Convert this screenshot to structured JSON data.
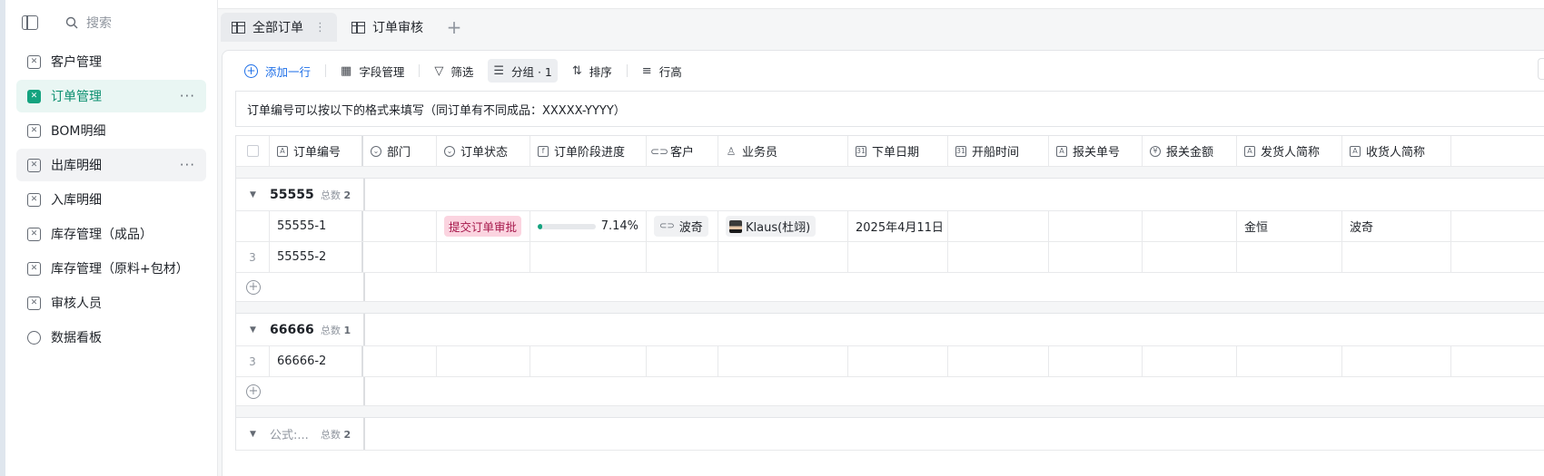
{
  "sidebar": {
    "search_placeholder": "搜索",
    "items": [
      {
        "label": "客户管理"
      },
      {
        "label": "订单管理"
      },
      {
        "label": "BOM明细"
      },
      {
        "label": "出库明细"
      },
      {
        "label": "入库明细"
      },
      {
        "label": "库存管理（成品）"
      },
      {
        "label": "库存管理（原料+包材）"
      },
      {
        "label": "审核人员"
      },
      {
        "label": "数据看板"
      }
    ],
    "more": "···"
  },
  "tabs": [
    {
      "label": "全部订单"
    },
    {
      "label": "订单审核"
    }
  ],
  "toolbar": {
    "add_row": "添加一行",
    "fields": "字段管理",
    "filter": "筛选",
    "group": "分组 · 1",
    "sort": "排序",
    "row_height": "行高"
  },
  "notice": "订单编号可以按以下的格式来填写（同订单有不同成品：XXXXX-YYYY）",
  "columns": [
    {
      "label": "订单编号",
      "icon": "text-icon"
    },
    {
      "label": "部门",
      "icon": "single-select-icon"
    },
    {
      "label": "订单状态",
      "icon": "single-select-icon"
    },
    {
      "label": "订单阶段进度",
      "icon": "formula-icon"
    },
    {
      "label": "客户",
      "icon": "link-icon"
    },
    {
      "label": "业务员",
      "icon": "person-icon"
    },
    {
      "label": "下单日期",
      "icon": "date-icon"
    },
    {
      "label": "开船时间",
      "icon": "date-icon"
    },
    {
      "label": "报关单号",
      "icon": "text-icon"
    },
    {
      "label": "报关金额",
      "icon": "currency-icon"
    },
    {
      "label": "发货人简称",
      "icon": "text-icon"
    },
    {
      "label": "收货人简称",
      "icon": "text-icon"
    }
  ],
  "groups": [
    {
      "name": "55555",
      "count_label": "总数",
      "count": "2",
      "rows": [
        {
          "index": "",
          "order_no": "55555-1",
          "status": "提交订单审批",
          "progress": 0.0714,
          "progress_text": "7.14%",
          "customer": "波奇",
          "salesperson": "Klaus(杜翊)",
          "order_date": "2025年4月11日",
          "shipper": "金恒",
          "consignee": "波奇"
        },
        {
          "index": "3",
          "order_no": "55555-2"
        }
      ]
    },
    {
      "name": "66666",
      "count_label": "总数",
      "count": "1",
      "rows": [
        {
          "index": "3",
          "order_no": "66666-2"
        }
      ]
    },
    {
      "name": "公式:...",
      "count_label": "总数",
      "count": "2",
      "rows": []
    }
  ]
}
